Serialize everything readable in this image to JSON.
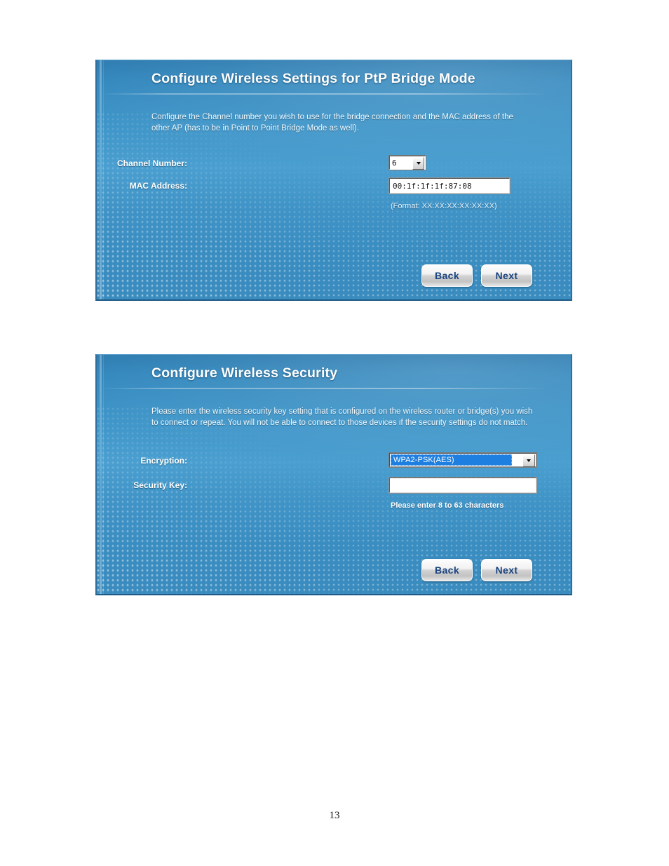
{
  "page": {
    "number": "13"
  },
  "panels": [
    {
      "id": "ptp-bridge",
      "title": "Configure Wireless Settings for PtP Bridge Mode",
      "description": "Configure the Channel number you wish to use for the bridge connection and the MAC address of the other AP (has to be in Point to Point Bridge Mode as well).",
      "fields": {
        "channel": {
          "label": "Channel Number:",
          "value": "6"
        },
        "mac": {
          "label": "MAC Address:",
          "value": "00:1f:1f:1f:87:08",
          "placeholder": "",
          "hint": "(Format: XX:XX:XX:XX:XX:XX)"
        }
      },
      "buttons": {
        "back": "Back",
        "next": "Next"
      }
    },
    {
      "id": "wireless-security",
      "title": "Configure Wireless Security",
      "description": "Please enter the wireless security key setting that is configured on the wireless router or bridge(s) you wish to connect or repeat. You will not be able to connect to those devices if the security settings do not match.",
      "fields": {
        "encryption": {
          "label": "Encryption:",
          "value": "WPA2-PSK(AES)"
        },
        "security_key": {
          "label": "Security Key:",
          "value": "",
          "placeholder": "",
          "hint": "Please enter 8 to 63 characters"
        }
      },
      "buttons": {
        "back": "Back",
        "next": "Next"
      }
    }
  ],
  "icons": {
    "dropdown_arrow": "chevron-down-icon"
  },
  "colors": {
    "panel_blue_top": "#2c7bb0",
    "panel_blue_mid": "#4a9fd0",
    "panel_border": "#2f6f9e",
    "button_text": "#18427e",
    "select_highlight": "#1f7fe0"
  }
}
